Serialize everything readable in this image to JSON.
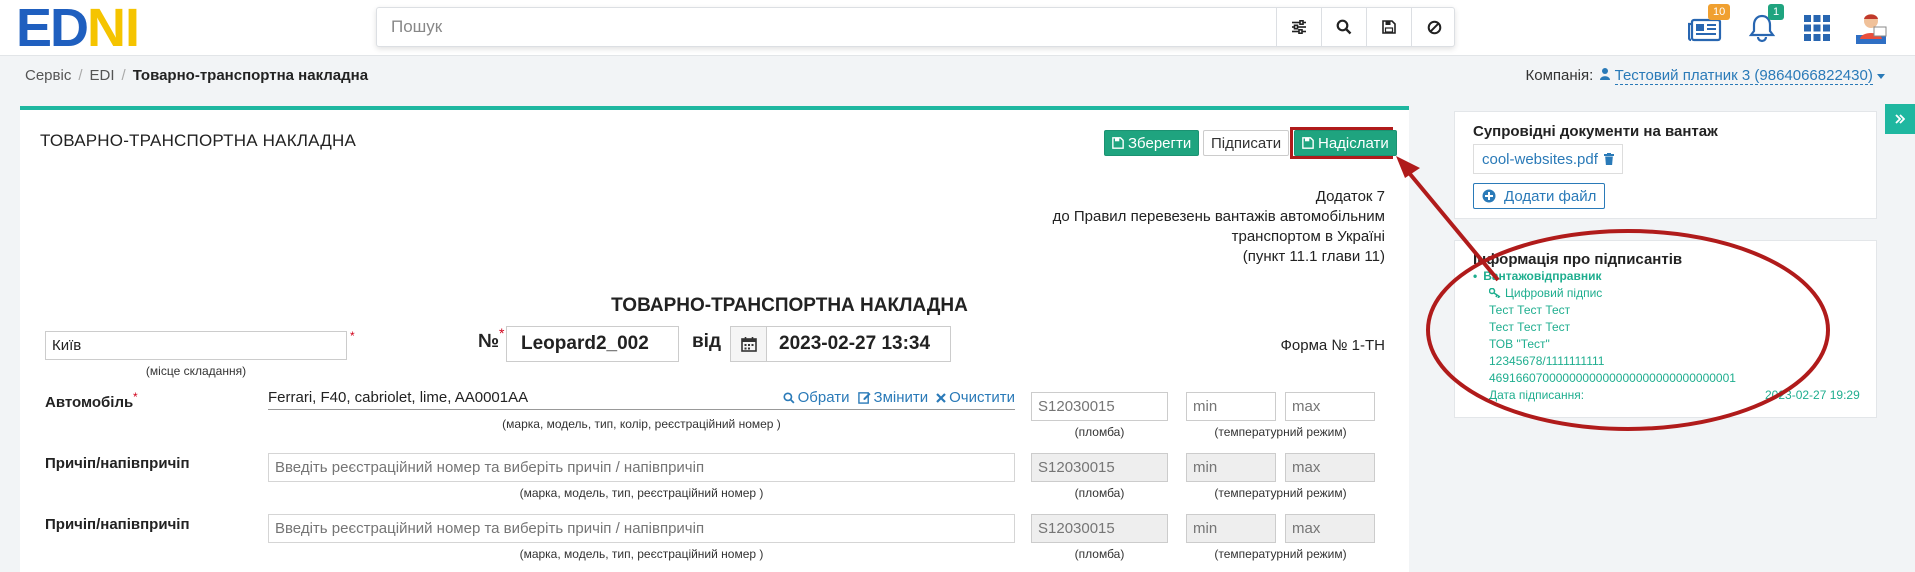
{
  "logo": {
    "part1": "ED",
    "part2": "N",
    "part3": "I"
  },
  "search": {
    "placeholder": "Пошук"
  },
  "top": {
    "news_badge": "10",
    "bell_badge": "1"
  },
  "breadcrumb": {
    "item1": "Сервіс",
    "item2": "EDI",
    "current": "Товарно-транспортна накладна"
  },
  "company": {
    "label": "Компанія:",
    "value": "Тестовий платник 3 (9864066822430)"
  },
  "panel": {
    "title": "ТОВАРНО-ТРАНСПОРТНА НАКЛАДНА",
    "save_label": "Зберегти",
    "sign_label": "Підписати",
    "send_label": "Надіслати"
  },
  "appendix": {
    "line1": "Додаток 7",
    "line2": "до Правил перевезень вантажів автомобільним",
    "line3": "транспортом в Україні",
    "line4": "(пункт 11.1 глави 11)"
  },
  "doc": {
    "heading": "ТОВАРНО-ТРАНСПОРТНА НАКЛАДНА",
    "place_value": "Київ",
    "place_caption": "(місце складання)",
    "number_label": "№",
    "number_value": "Leopard2_002",
    "from_label": "від",
    "date_value": "2023-02-27 13:34",
    "form_label": "Форма № 1-ТН"
  },
  "car": {
    "label": "Автомобіль",
    "value": "Ferrari, F40, cabriolet, lime, AA0001AA",
    "choose": "Обрати",
    "change": "Змінити",
    "clear": "Очистити",
    "caption": "(марка, модель, тип, колір, реєстраційний номер )",
    "seal_placeholder": "S12030015",
    "seal_caption": "(пломба)",
    "min_placeholder": "min",
    "max_placeholder": "max",
    "temp_caption": "(температурний режим)"
  },
  "trailers": [
    {
      "label": "Причіп/напівпричіп",
      "placeholder": "Введіть реєстраційний номер та виберіть причіп / напівпричіп",
      "caption": "(марка, модель, тип, реєстраційний номер )",
      "seal_placeholder": "S12030015",
      "seal_caption": "(пломба)",
      "min_placeholder": "min",
      "max_placeholder": "max",
      "temp_caption": "(температурний режим)"
    },
    {
      "label": "Причіп/напівпричіп",
      "placeholder": "Введіть реєстраційний номер та виберіть причіп / напівпричіп",
      "caption": "(марка, модель, тип, реєстраційний номер )",
      "seal_placeholder": "S12030015",
      "seal_caption": "(пломба)",
      "min_placeholder": "min",
      "max_placeholder": "max",
      "temp_caption": "(температурний режим)"
    }
  ],
  "attachments": {
    "title": "Супровідні документи на вантаж",
    "file_name": "cool-websites.pdf",
    "add_file": "Додати файл"
  },
  "signers": {
    "title": "Інформація про підписантів",
    "role": "Вантажовідправник",
    "signature_type": "Цифровий підпис",
    "line1": "Тест Тест Тест",
    "line2": "Тест Тест Тест",
    "line3": "ТОВ \"Тест\"",
    "line4": "12345678/1111111111",
    "line5": "4691660700000000000000000000000000001",
    "date_label": "Дата підписання:",
    "date_value": "2023-02-27 19:29"
  },
  "colors": {
    "accent": "#1fb7a0",
    "primary_green": "#1fa47f",
    "link": "#2a7ab8",
    "annotation_red": "#b01b1b"
  }
}
